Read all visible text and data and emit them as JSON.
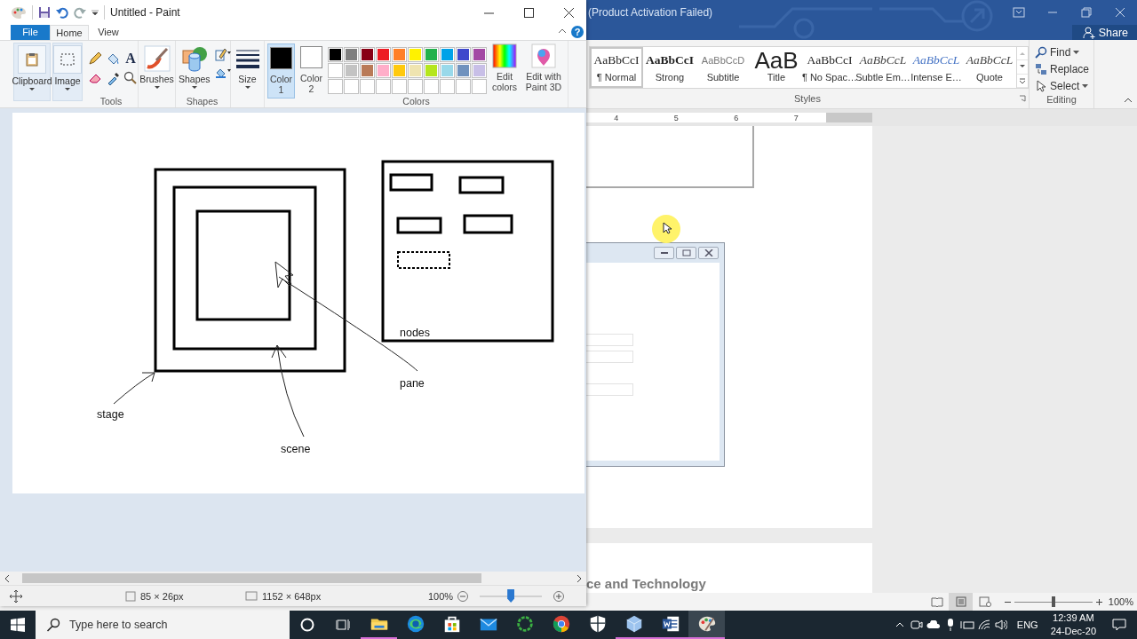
{
  "paint": {
    "title": "Untitled - Paint",
    "tabs": [
      {
        "label": "File",
        "kind": "file",
        "selected": false
      },
      {
        "label": "Home",
        "kind": "tab",
        "selected": true
      },
      {
        "label": "View",
        "kind": "tab",
        "selected": false
      }
    ],
    "help": "?",
    "big_tools": [
      {
        "label": "Clipboard",
        "kind": "clipboard"
      },
      {
        "label": "Image",
        "kind": "image"
      }
    ],
    "text_tool": "A",
    "tools_label": "Tools",
    "brushes": "Brushes",
    "shapes": "Shapes",
    "shapes_label": "Shapes",
    "size": "Size",
    "color_slots": [
      {
        "label": "Color 1",
        "color": "#000000",
        "selected": true
      },
      {
        "label": "Color 2",
        "color": "#ffffff",
        "selected": false
      }
    ],
    "palette": [
      {
        "color": "#000000"
      },
      {
        "color": "#7f7f7f"
      },
      {
        "color": "#880015"
      },
      {
        "color": "#ed1c24"
      },
      {
        "color": "#ff7f27"
      },
      {
        "color": "#fff200"
      },
      {
        "color": "#22b14c"
      },
      {
        "color": "#00a2e8"
      },
      {
        "color": "#3f48cc"
      },
      {
        "color": "#a349a4"
      },
      {
        "color": "#ffffff"
      },
      {
        "color": "#c3c3c3"
      },
      {
        "color": "#b97a57"
      },
      {
        "color": "#ffaec9"
      },
      {
        "color": "#ffc90e"
      },
      {
        "color": "#efe4b0"
      },
      {
        "color": "#b5e61d"
      },
      {
        "color": "#99d9ea"
      },
      {
        "color": "#7092be"
      },
      {
        "color": "#c8bfe7"
      }
    ],
    "edit_colors": "Edit colors",
    "edit_3d": "Edit with Paint 3D",
    "colors_label": "Colors",
    "canvas_labels": [
      "nodes",
      "pane",
      "stage",
      "scene"
    ],
    "status": {
      "selection": "85 × 26px",
      "image": "1152 × 648px",
      "zoom": "100%",
      "zoom_slider": {
        "level": 0.5
      }
    }
  },
  "word": {
    "title": "(Product Activation Failed)",
    "share": "Share",
    "styles": [
      {
        "preview": "AaBbCcI",
        "name": "¶ Normal",
        "kind": "normal",
        "selected": true
      },
      {
        "preview": "AaBbCcI",
        "name": "Strong",
        "kind": "strong",
        "selected": false
      },
      {
        "preview": "AaBbCcD",
        "name": "Subtitle",
        "kind": "subtitle",
        "selected": false
      },
      {
        "preview": "AaB",
        "name": "Title",
        "kind": "title",
        "selected": false
      },
      {
        "preview": "AaBbCcI",
        "name": "¶ No Spac…",
        "kind": "nospacing",
        "selected": false
      },
      {
        "preview": "AaBbCcL",
        "name": "Subtle Em…",
        "kind": "subtle",
        "selected": false
      },
      {
        "preview": "AaBbCcL",
        "name": "Intense E…",
        "kind": "intense",
        "selected": false
      },
      {
        "preview": "AaBbCcL",
        "name": "Quote",
        "kind": "quote",
        "selected": false
      }
    ],
    "styles_label": "Styles",
    "editing": [
      {
        "label": "Find",
        "kind": "find",
        "dropdown": true
      },
      {
        "label": "Replace",
        "kind": "replace",
        "dropdown": false
      },
      {
        "label": "Select",
        "kind": "select",
        "dropdown": true
      }
    ],
    "editing_label": "Editing",
    "ruler": [
      "4",
      "5",
      "6",
      "7"
    ],
    "page_heading": "ce and Technology",
    "zoom": "100%",
    "zoom_slider": {
      "level": 0.5
    }
  },
  "taskbar": {
    "search_placeholder": "Type here to search",
    "apps": [
      {
        "kind": "explorer",
        "running": true,
        "selected": false
      },
      {
        "kind": "edge",
        "running": false,
        "selected": false
      },
      {
        "kind": "store",
        "running": false,
        "selected": false
      },
      {
        "kind": "mail",
        "running": false,
        "selected": false
      },
      {
        "kind": "ring",
        "running": false,
        "selected": false
      },
      {
        "kind": "chrome",
        "running": false,
        "selected": false
      },
      {
        "kind": "shield",
        "running": false,
        "selected": false
      },
      {
        "kind": "cube",
        "running": true,
        "selected": false
      },
      {
        "kind": "word",
        "running": true,
        "selected": false
      },
      {
        "kind": "paint",
        "running": true,
        "selected": true
      }
    ],
    "language": "ENG",
    "time": "12:39 AM",
    "date": "24-Dec-20"
  }
}
